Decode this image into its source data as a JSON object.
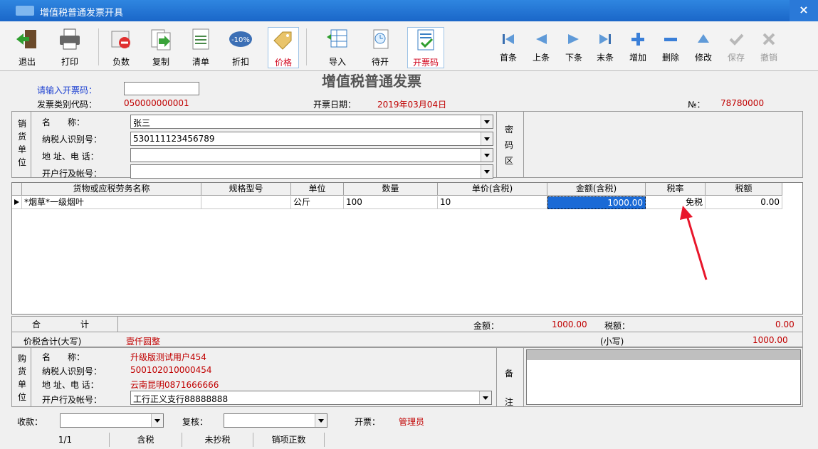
{
  "window": {
    "title": "增值税普通发票开具",
    "close": "×"
  },
  "toolbar": {
    "exit": "退出",
    "print": "打印",
    "negative": "负数",
    "copy": "复制",
    "list": "清单",
    "discount": "折扣",
    "discount_badge": "-10%",
    "price": "价格",
    "import": "导入",
    "pending": "待开",
    "invoice_code": "开票码"
  },
  "nav": {
    "first": "首条",
    "prev": "上条",
    "next": "下条",
    "last": "末条",
    "add": "增加",
    "delete": "删除",
    "modify": "修改",
    "save": "保存",
    "cancel": "撤销"
  },
  "header": {
    "doc_title": "增值税普通发票",
    "code_prompt": "请输入开票码：",
    "type_code_label": "发票类别代码：",
    "type_code_value": "050000000001",
    "date_label": "开票日期：",
    "date_value": "2019年03月04日",
    "no_label": "№：",
    "no_value": "78780000"
  },
  "seller": {
    "side_label": [
      "销",
      "货",
      "单",
      "位"
    ],
    "name_label": "名　　称：",
    "name_value": "张三",
    "tax_id_label": "纳税人识别号：",
    "tax_id_value": "530111123456789",
    "addr_label": "地 址、电 话：",
    "addr_value": "",
    "bank_label": "开户行及帐号：",
    "bank_value": "",
    "cipher_label": [
      "密",
      "码",
      "区"
    ]
  },
  "table": {
    "columns": [
      "货物或应税劳务名称",
      "规格型号",
      "单位",
      "数量",
      "单价(含税)",
      "金额(含税)",
      "税率",
      "税额"
    ],
    "rows": [
      {
        "name": "*烟草*一级烟叶",
        "spec": "",
        "unit": "公斤",
        "qty": "100",
        "price": "10",
        "amount": "1000.00",
        "rate": "免税",
        "tax": "0.00"
      }
    ]
  },
  "totals": {
    "sum_label1": "合",
    "sum_label2": "计",
    "amount_label": "金额：",
    "amount_value": "1000.00",
    "tax_label": "税额：",
    "tax_value": "0.00",
    "total_upper_label": "价税合计(大写)",
    "total_upper_value": "壹仟圆整",
    "total_lower_label": "(小写)",
    "total_lower_value": "1000.00"
  },
  "buyer": {
    "side_label": [
      "购",
      "货",
      "单",
      "位"
    ],
    "name_label": "名　　称：",
    "name_value": "升级版测试用户454",
    "tax_id_label": "纳税人识别号：",
    "tax_id_value": "500102010000454",
    "addr_label": "地 址、电 话：",
    "addr_value": "云南昆明0871666666",
    "bank_label": "开户行及帐号：",
    "bank_value": "工行正义支行88888888",
    "remark_label": [
      "备",
      "注"
    ]
  },
  "footer": {
    "payee_label": "收款：",
    "reviewer_label": "复核：",
    "issuer_label": "开票：",
    "issuer_value": "管理员"
  },
  "status": {
    "page": "1/1",
    "tax_mode": "含税",
    "copy_state": "未抄税",
    "type": "销项正数"
  },
  "colors": {
    "title_bar": "#1a66c8",
    "label_blue": "#1b3fd1",
    "value_red": "#c00000",
    "selection": "#1a6ad6",
    "arrow": "#e8162b"
  }
}
